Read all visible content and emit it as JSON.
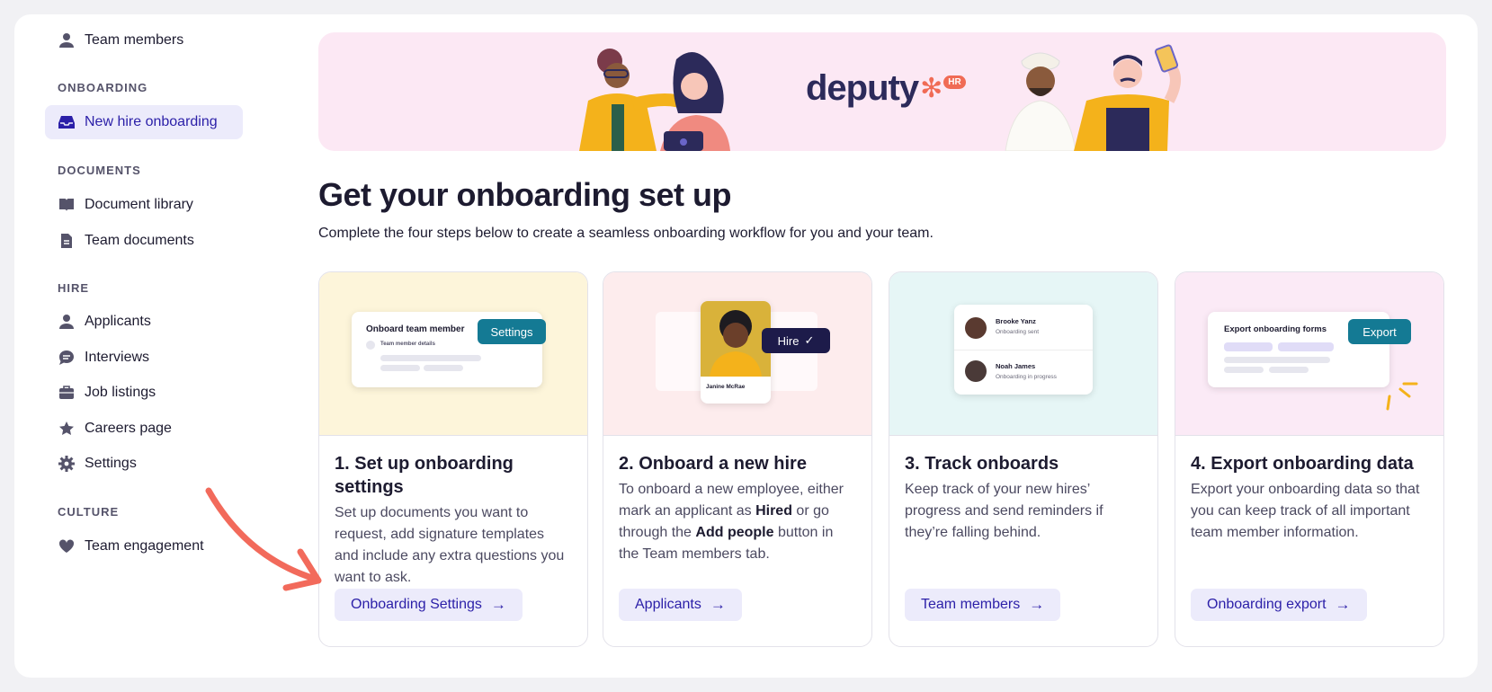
{
  "sidebar": {
    "team_members": "Team members",
    "sections": {
      "onboarding": "ONBOARDING",
      "documents": "DOCUMENTS",
      "hire": "HIRE",
      "culture": "CULTURE"
    },
    "items": {
      "new_hire_onboarding": "New hire onboarding",
      "document_library": "Document library",
      "team_documents": "Team documents",
      "applicants": "Applicants",
      "interviews": "Interviews",
      "job_listings": "Job listings",
      "careers_page": "Careers page",
      "settings": "Settings",
      "team_engagement": "Team engagement"
    }
  },
  "banner": {
    "brand": "deputy",
    "badge": "HR"
  },
  "main": {
    "title": "Get your onboarding set up",
    "subtitle": "Complete the four steps below to create a seamless onboarding workflow for you and your team."
  },
  "cards": [
    {
      "title": "1. Set up onboarding settings",
      "cta": "Onboarding Settings",
      "illus": {
        "heading": "Onboard team member",
        "row": "Team member details",
        "button": "Settings"
      }
    },
    {
      "title": "2. Onboard a new hire",
      "cta": "Applicants",
      "illus": {
        "name": "Janine McRae",
        "button": "Hire"
      }
    },
    {
      "title": "3. Track onboards",
      "description": "Keep track of your new hires’ progress and send reminders if they’re falling behind.",
      "cta": "Team members",
      "illus": {
        "person1": "Brooke Yanz",
        "status1": "Onboarding sent",
        "person2": "Noah James",
        "status2": "Onboarding in progress"
      }
    },
    {
      "title": "4. Export onboarding data",
      "description": "Export your onboarding data so that you can keep track of all important team member information.",
      "cta": "Onboarding export",
      "illus": {
        "heading": "Export onboarding forms",
        "button": "Export"
      }
    }
  ],
  "card1_description": "Set up documents you want to request, add signature templates and include any extra questions you want to ask.",
  "card2_description": {
    "part1": "To onboard a new employee, either mark an applicant as ",
    "hired": "Hired",
    "part2": " or go through the ",
    "add_people": "Add people",
    "part3": " button in the Team members tab."
  },
  "colors": {
    "accent": "#2b1fa8",
    "accent_bg": "#ecebfb",
    "teal": "#147a94",
    "arrow": "#f26a5b"
  },
  "icons": [
    "person-icon",
    "inbox-icon",
    "book-icon",
    "document-icon",
    "chat-icon",
    "briefcase-icon",
    "star-icon",
    "gear-icon",
    "heart-icon",
    "arrow-right-icon",
    "check-icon"
  ]
}
